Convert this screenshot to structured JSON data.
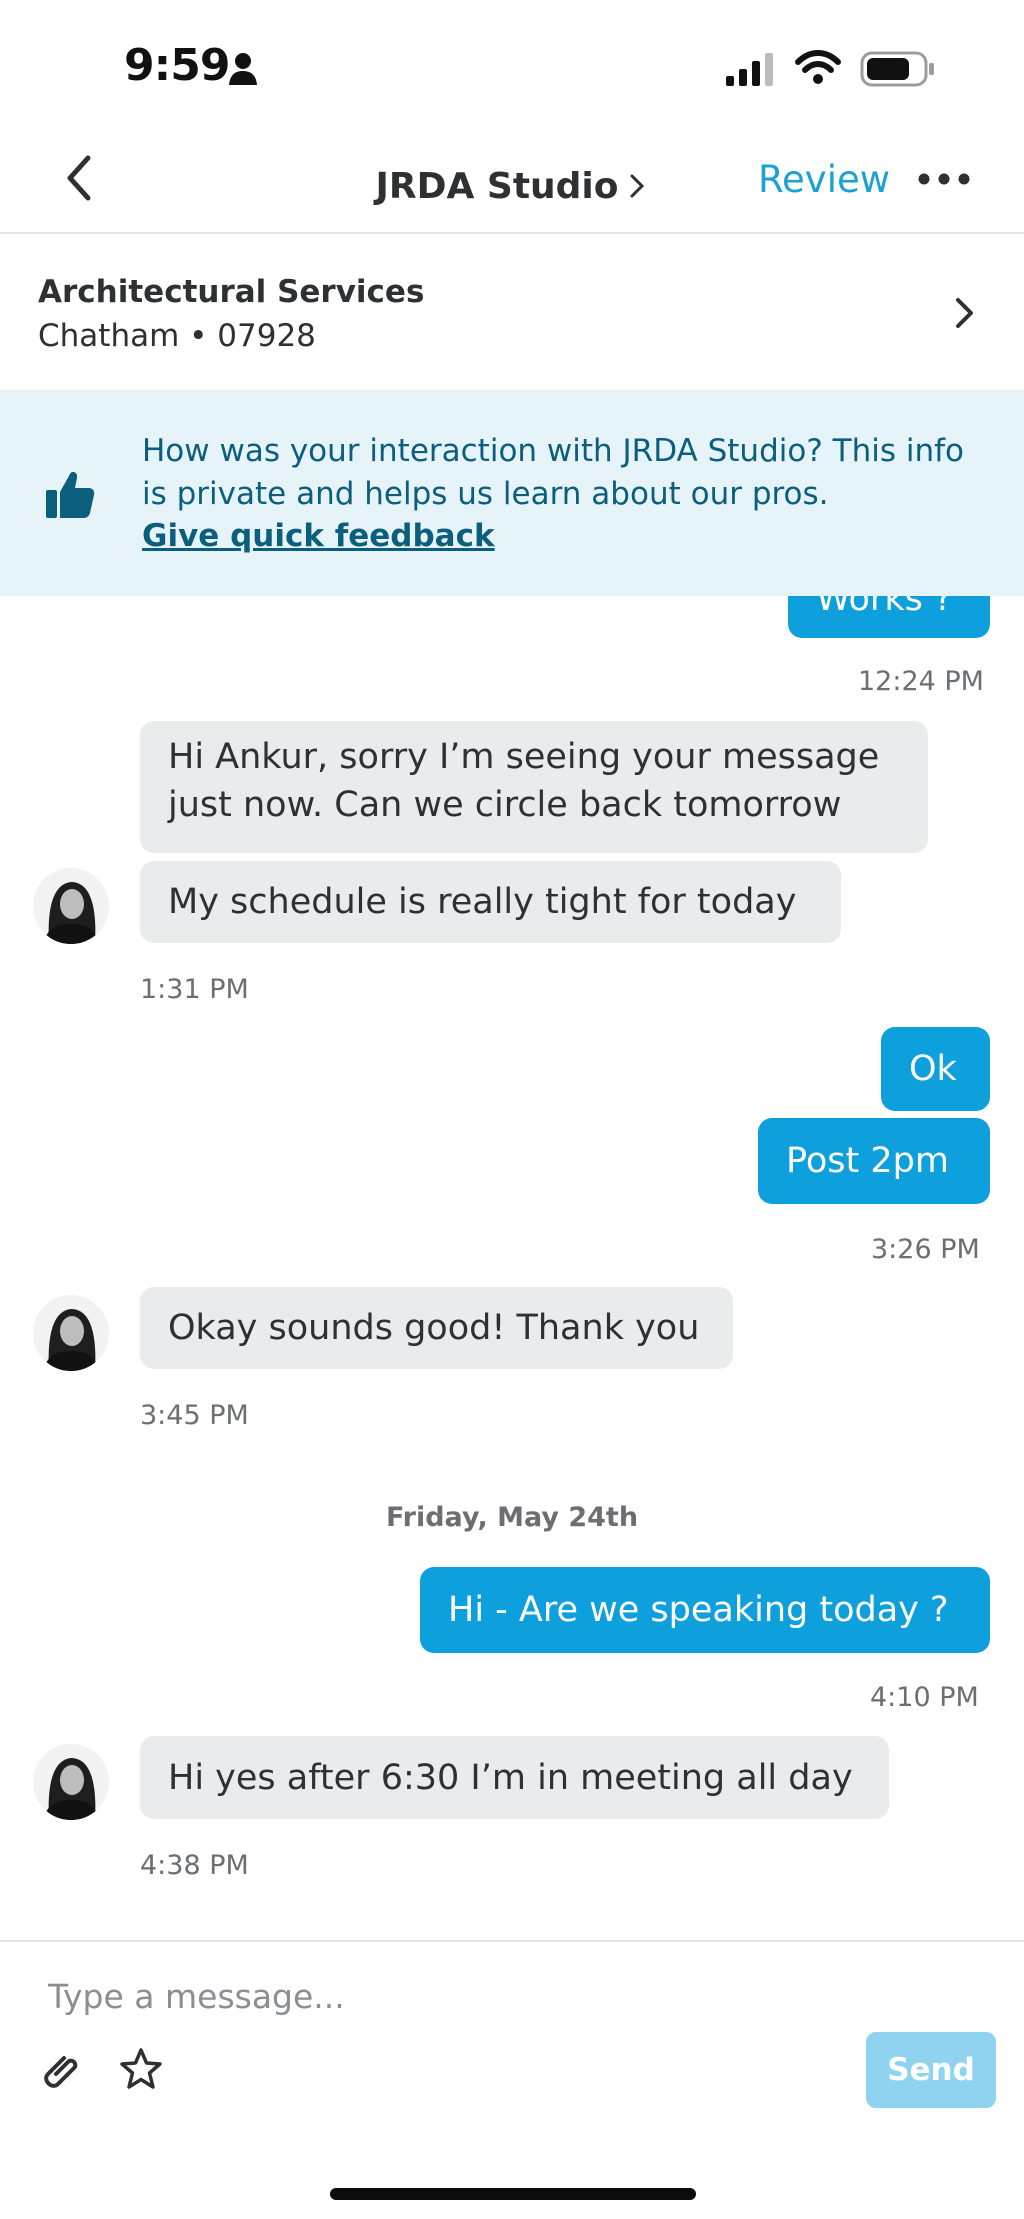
{
  "status_bar": {
    "time": "9:59"
  },
  "nav": {
    "back_icon": "chevron-left-icon",
    "title": "JRDA Studio",
    "review": "Review",
    "more_icon": "more-horizontal-icon"
  },
  "service": {
    "title": "Architectural Services",
    "location": "Chatham • 07928"
  },
  "feedback": {
    "text": "How was your interaction with JRDA Studio? This info is private and helps us learn about our pros.",
    "link": "Give quick feedback",
    "icon": "thumbs-up-icon"
  },
  "messages": {
    "partial_out": "Works ?",
    "time_1": "12:24 PM",
    "in_1": "Hi Ankur, sorry I’m seeing your message just now. Can we circle back tomorrow",
    "in_2": "My schedule is really tight for today",
    "time_2": "1:31 PM",
    "out_1": "Ok",
    "out_2": "Post 2pm",
    "time_3": "3:26 PM",
    "in_3": "Okay sounds good! Thank you",
    "time_4": "3:45 PM",
    "date_divider": "Friday, May 24th",
    "out_3": "Hi - Are we speaking today ?",
    "time_5": "4:10 PM",
    "in_4": "Hi yes after 6:30 I’m in meeting all day",
    "time_6": "4:38 PM"
  },
  "composer": {
    "placeholder": "Type a message...",
    "send": "Send"
  },
  "colors": {
    "accent": "#0da0dc",
    "banner_bg": "#e6f4fa",
    "banner_text": "#0b5f7c",
    "incoming_bg": "#e9ebed",
    "send_disabled": "#8fd3f0"
  }
}
